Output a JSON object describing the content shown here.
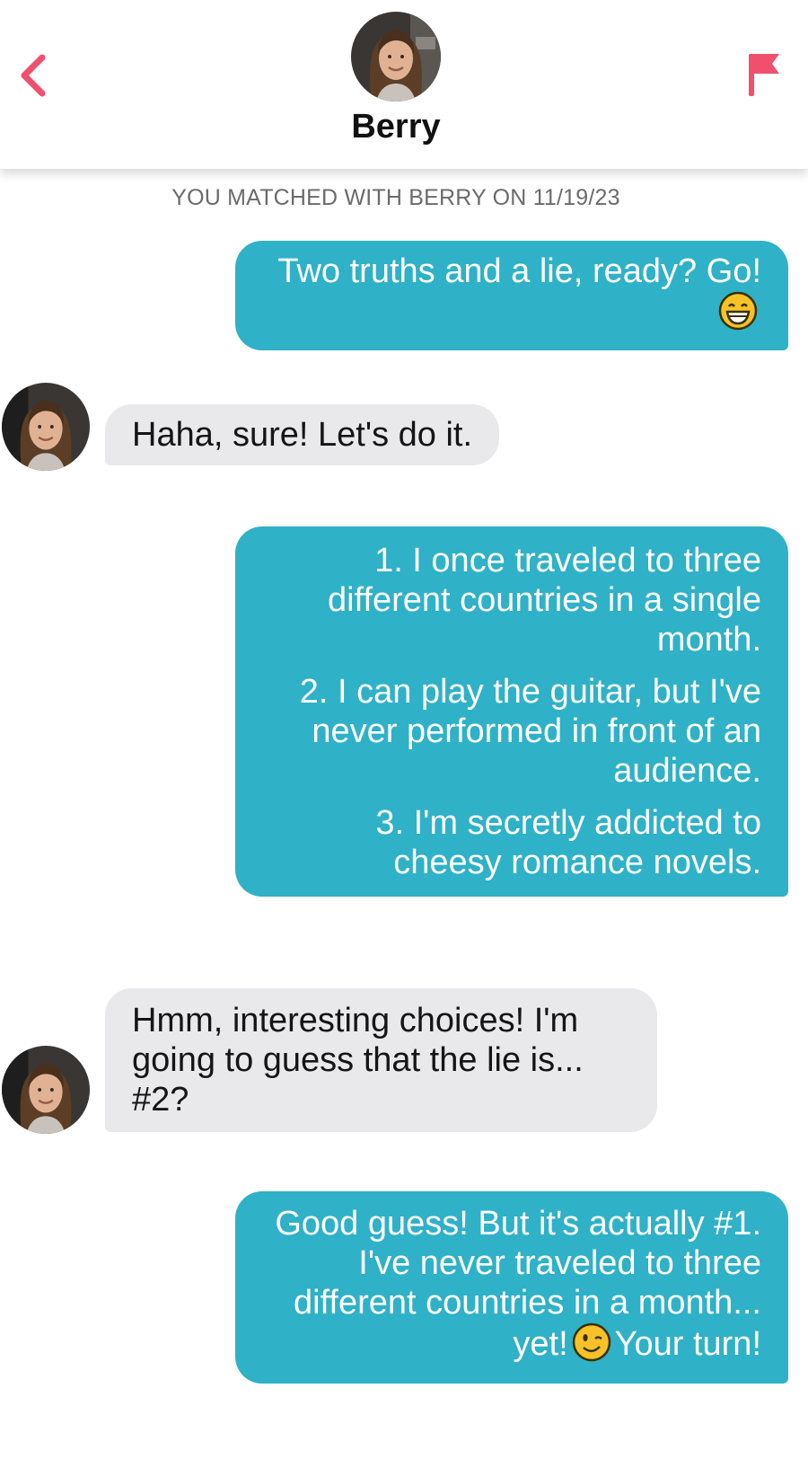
{
  "header": {
    "contact_name": "Berry",
    "back_icon": "chevron-left-icon",
    "report_icon": "flag-icon",
    "accent_color": "#f0506e"
  },
  "match_notice": "YOU MATCHED WITH BERRY ON 11/19/23",
  "colors": {
    "sent_bubble": "#2fb1c8",
    "received_bubble": "#e9e9eb"
  },
  "messages": [
    {
      "sender": "me",
      "paragraphs": [
        {
          "text": "Two truths and a lie, ready? Go!",
          "emoji": "grinning-face-icon",
          "after": ""
        }
      ]
    },
    {
      "sender": "Berry",
      "paragraphs": [
        {
          "text": "Haha, sure! Let's do it."
        }
      ]
    },
    {
      "sender": "me",
      "paragraphs": [
        {
          "text": "1. I once traveled to three different countries in a single month."
        },
        {
          "text": "2. I can play the guitar, but I've never performed in front of an audience."
        },
        {
          "text": "3. I'm secretly addicted to cheesy romance novels."
        }
      ]
    },
    {
      "sender": "Berry",
      "paragraphs": [
        {
          "text": "Hmm, interesting choices! I'm going to guess that the lie is... #2?"
        }
      ]
    },
    {
      "sender": "me",
      "paragraphs": [
        {
          "text": "Good guess! But it's actually #1. I've never traveled to three different countries in a month... yet!",
          "emoji": "winking-face-icon",
          "after": "Your turn!"
        }
      ]
    }
  ]
}
